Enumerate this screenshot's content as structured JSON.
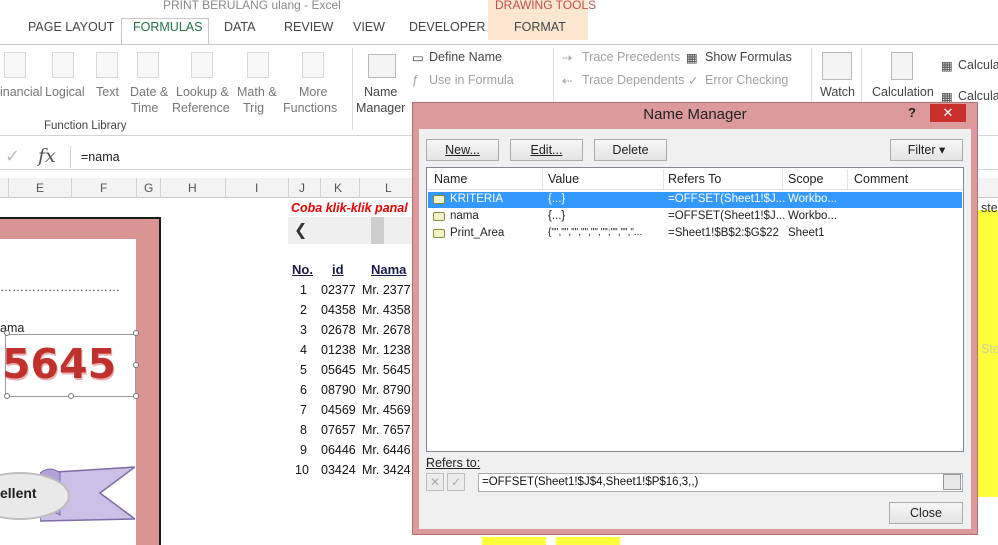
{
  "window": {
    "title": "PRINT BERULANG ulang - Excel",
    "context_tab_group": "DRAWING TOOLS"
  },
  "tabs": [
    "PAGE LAYOUT",
    "FORMULAS",
    "DATA",
    "REVIEW",
    "VIEW",
    "DEVELOPER",
    "FORMAT"
  ],
  "active_tab": "FORMULAS",
  "ribbon": {
    "function_library": {
      "label": "Function Library",
      "buttons": [
        {
          "line1": "inancial",
          "line2": ""
        },
        {
          "line1": "Logical",
          "line2": ""
        },
        {
          "line1": "Text",
          "line2": ""
        },
        {
          "line1": "Date &",
          "line2": "Time"
        },
        {
          "line1": "Lookup &",
          "line2": "Reference"
        },
        {
          "line1": "Math &",
          "line2": "Trig"
        },
        {
          "line1": "More",
          "line2": "Functions"
        }
      ]
    },
    "defined_names": {
      "name_manager_line1": "Name",
      "name_manager_line2": "Manager",
      "define_name": "Define Name",
      "use_in_formula": "Use in Formula"
    },
    "formula_auditing": {
      "trace_precedents": "Trace Precedents",
      "trace_dependents": "Trace Dependents",
      "show_formulas": "Show Formulas",
      "error_checking": "Error Checking",
      "watch": "Watch",
      "calculation": "Calculation",
      "calculate_1": "Calculat",
      "calculate_2": "Calculat"
    }
  },
  "formula_bar": {
    "content": "=nama"
  },
  "columns": [
    "E",
    "F",
    "G",
    "H",
    "I",
    "J",
    "K",
    "L"
  ],
  "sheet": {
    "red_instruction": "Coba klik-klik panal",
    "dots": "…………………………",
    "nama_label": "ama",
    "big_number": "5645",
    "excellent_label": "ellent",
    "right_edge_text": "ste",
    "right_faint_text": "Ste",
    "table_headers": {
      "no": "No.",
      "id": "id",
      "nama": "Nama"
    },
    "rows": [
      {
        "no": "1",
        "id": "02377",
        "nama": "Mr. 2377"
      },
      {
        "no": "2",
        "id": "04358",
        "nama": "Mr. 4358"
      },
      {
        "no": "3",
        "id": "02678",
        "nama": "Mr. 2678"
      },
      {
        "no": "4",
        "id": "01238",
        "nama": "Mr. 1238"
      },
      {
        "no": "5",
        "id": "05645",
        "nama": "Mr. 5645"
      },
      {
        "no": "6",
        "id": "08790",
        "nama": "Mr. 8790"
      },
      {
        "no": "7",
        "id": "04569",
        "nama": "Mr. 4569"
      },
      {
        "no": "8",
        "id": "07657",
        "nama": "Mr. 7657"
      },
      {
        "no": "9",
        "id": "06446",
        "nama": "Mr. 6446"
      },
      {
        "no": "10",
        "id": "03424",
        "nama": "Mr. 3424"
      }
    ]
  },
  "dialog": {
    "title": "Name Manager",
    "help": "?",
    "close_x": "✕",
    "buttons": {
      "new": "New...",
      "edit": "Edit...",
      "delete": "Delete",
      "filter": "Filter ▾",
      "close": "Close"
    },
    "columns": [
      "Name",
      "Value",
      "Refers To",
      "Scope",
      "Comment"
    ],
    "names": [
      {
        "name": "KRITERIA",
        "value": "{...}",
        "refers_to": "=OFFSET(Sheet1!$J...",
        "scope": "Workbo...",
        "comment": ""
      },
      {
        "name": "nama",
        "value": "{...}",
        "refers_to": "=OFFSET(Sheet1!$J...",
        "scope": "Workbo...",
        "comment": ""
      },
      {
        "name": "Print_Area",
        "value": "{\"\",\"\",\"\",\"\",\"\",\"\";\"\",\"\",\"...",
        "refers_to": "=Sheet1!$B$2:$G$22",
        "scope": "Sheet1",
        "comment": ""
      }
    ],
    "refers_to_label": "Refers to:",
    "refers_to_value": "=OFFSET(Sheet1!$J$4,Sheet1!$P$16,3,,)"
  },
  "colors": {
    "dialog_frame": "#dc9a9c",
    "selection": "#3399ff",
    "accent_green": "#217346",
    "red_text": "#ee0000"
  }
}
